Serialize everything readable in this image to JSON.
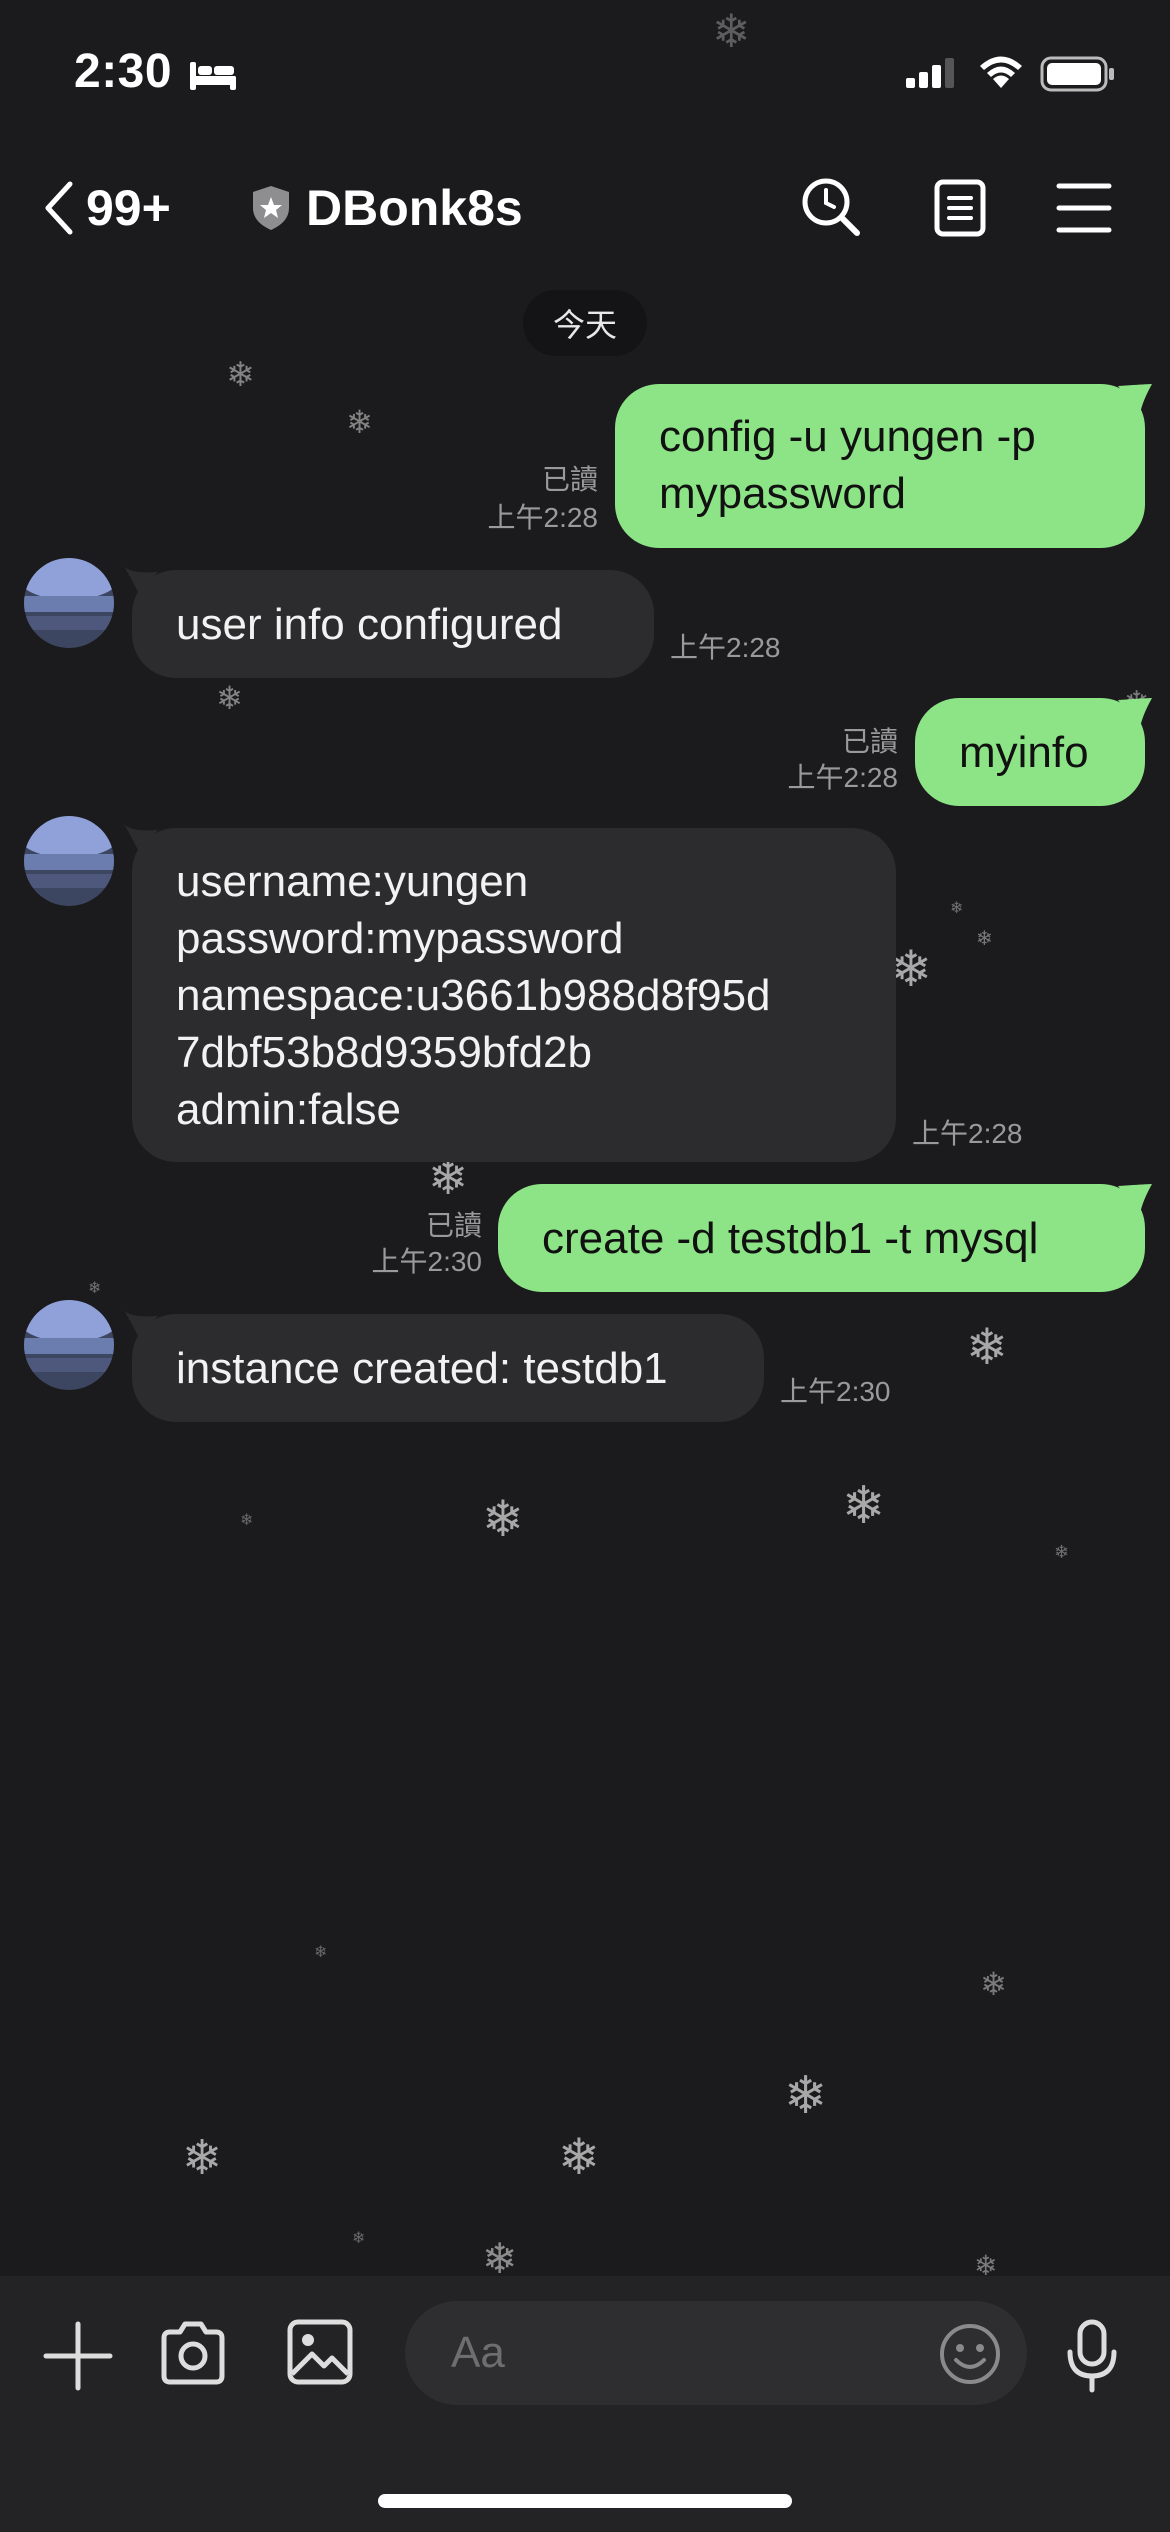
{
  "status_bar": {
    "time": "2:30",
    "icons": [
      "bed-icon",
      "signal-icon",
      "wifi-icon",
      "battery-icon"
    ]
  },
  "header": {
    "unread_count": "99+",
    "chat_title": "DBonk8s",
    "icons": [
      "back-chevron-icon",
      "shield-star-icon",
      "search-clock-icon",
      "notes-icon",
      "menu-icon"
    ]
  },
  "date_chip": "今天",
  "messages": [
    {
      "direction": "out",
      "lines": [
        "config -u yungen -p",
        "mypassword"
      ],
      "read": "已讀",
      "time": "上午2:28"
    },
    {
      "direction": "in",
      "lines": [
        "user info configured"
      ],
      "time": "上午2:28"
    },
    {
      "direction": "out",
      "lines": [
        "myinfo"
      ],
      "read": "已讀",
      "time": "上午2:28"
    },
    {
      "direction": "in",
      "lines": [
        "username:yungen",
        "password:mypassword",
        "namespace:u3661b988d8f95d",
        "7dbf53b8d9359bfd2b",
        "admin:false"
      ],
      "time": "上午2:28"
    },
    {
      "direction": "out",
      "lines": [
        "create -d testdb1 -t mysql"
      ],
      "read": "已讀",
      "time": "上午2:30"
    },
    {
      "direction": "in",
      "lines": [
        "instance created: testdb1"
      ],
      "time": "上午2:30"
    }
  ],
  "composer": {
    "placeholder": "Aa",
    "icons": [
      "plus-icon",
      "camera-icon",
      "image-icon",
      "emoji-icon",
      "microphone-icon"
    ]
  },
  "colors": {
    "background": "#1b1b1d",
    "outgoing_bubble": "#8de487",
    "incoming_bubble": "#2c2c2e",
    "bottom_bar": "#232325"
  }
}
